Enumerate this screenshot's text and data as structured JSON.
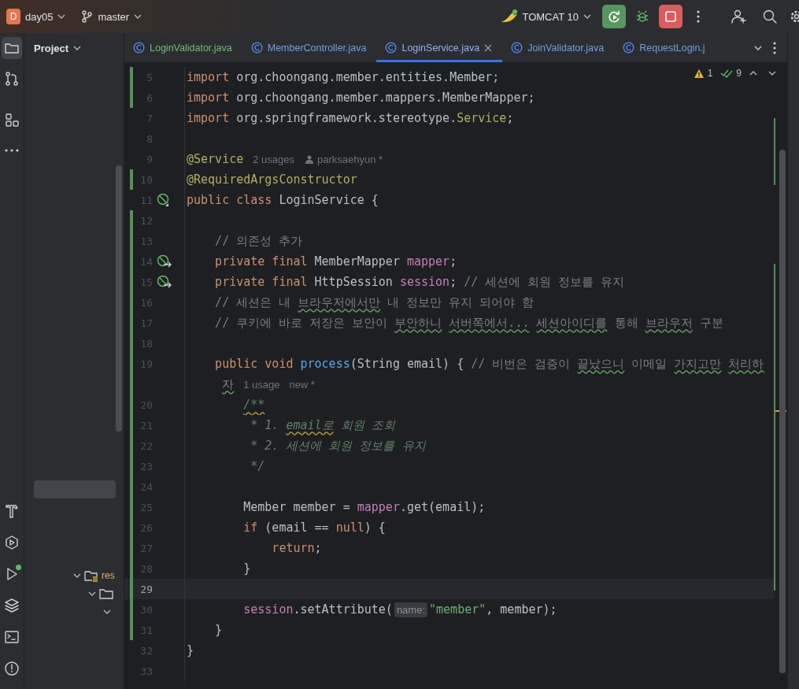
{
  "toolbar": {
    "project_badge": "D",
    "project": "day05",
    "branch": "master",
    "run_config": "TOMCAT 10"
  },
  "tool_strip": [
    {
      "kind": "project",
      "selected": true,
      "indicator": false
    },
    {
      "kind": "commit",
      "selected": false,
      "indicator": false
    },
    {
      "kind": "structure",
      "selected": false,
      "indicator": false
    },
    {
      "kind": "more",
      "selected": false,
      "indicator": false
    },
    {
      "kind": "build",
      "selected": false,
      "indicator": false
    },
    {
      "kind": "services",
      "selected": false,
      "indicator": false
    },
    {
      "kind": "run",
      "selected": false,
      "indicator": true
    },
    {
      "kind": "layers",
      "selected": false,
      "indicator": false
    },
    {
      "kind": "terminal",
      "selected": false,
      "indicator": false
    },
    {
      "kind": "problems",
      "selected": false,
      "indicator": false
    }
  ],
  "project_panel": {
    "title": "Project",
    "tree": [
      {
        "label": "res",
        "kind": "resources-folder",
        "expanded": true,
        "children": [
          {
            "kind": "folder",
            "expanded": true,
            "children": [
              {
                "expanded": true
              }
            ]
          }
        ]
      }
    ]
  },
  "tabs": [
    {
      "label": "LoginValidator.java",
      "color": "#73bd79",
      "selected": false
    },
    {
      "label": "MemberController.java",
      "color": "#6f9fe8",
      "selected": false
    },
    {
      "label": "LoginService.java",
      "color": "#8fb3f2",
      "selected": true
    },
    {
      "label": "JoinValidator.java",
      "color": "#6f9fe8",
      "selected": false
    },
    {
      "label": "RequestLogin.j",
      "color": "#6f9fe8",
      "selected": false
    }
  ],
  "inspections": {
    "warnings": "1",
    "weak_warnings": "9"
  },
  "editor": {
    "lines": [
      {
        "number": "5",
        "changed": true,
        "current": false,
        "tokens": [
          {
            "kind": "keyword",
            "text": "import"
          },
          {
            "kind": "plain",
            "text": " org.choongang.member.entities.Member;"
          }
        ]
      },
      {
        "number": "6",
        "changed": true,
        "current": false,
        "tokens": [
          {
            "kind": "keyword",
            "text": "import"
          },
          {
            "kind": "plain",
            "text": " org.choongang.member.mappers.MemberMapper;"
          }
        ]
      },
      {
        "number": "7",
        "changed": false,
        "current": false,
        "tokens": [
          {
            "kind": "keyword",
            "text": "import"
          },
          {
            "kind": "plain",
            "text": " org.springframework.stereotype."
          },
          {
            "kind": "annotation",
            "text": "Service"
          },
          {
            "kind": "plain",
            "text": ";"
          }
        ]
      },
      {
        "number": "8",
        "changed": false,
        "current": false
      },
      {
        "number": "9",
        "changed": false,
        "current": false,
        "tokens": [
          {
            "kind": "annotation",
            "text": "@Service"
          },
          {
            "kind": "hint",
            "text": "2 usages"
          },
          {
            "kind": "author",
            "text": "parksaehyun *"
          }
        ]
      },
      {
        "number": "10",
        "changed": true,
        "current": false,
        "tokens": [
          {
            "kind": "annotation",
            "text": "@RequiredArgsConstructor"
          }
        ]
      },
      {
        "number": "11",
        "changed": false,
        "current": false,
        "gutter": {
          "kind": "bean"
        },
        "tokens": [
          {
            "kind": "keyword",
            "text": "public class"
          },
          {
            "kind": "plain",
            "text": " LoginService {"
          }
        ]
      },
      {
        "number": "12",
        "changed": true,
        "current": false
      },
      {
        "number": "13",
        "changed": true,
        "current": false,
        "tokens": [
          {
            "kind": "comment",
            "text": "    // 의존성 추가"
          }
        ]
      },
      {
        "number": "14",
        "changed": true,
        "current": false,
        "gutter": {
          "kind": "injected-bean"
        },
        "tokens": [
          {
            "kind": "keyword",
            "text": "    private final"
          },
          {
            "kind": "plain",
            "text": " MemberMapper "
          },
          {
            "kind": "field",
            "text": "mapper"
          },
          {
            "kind": "plain",
            "text": ";"
          }
        ]
      },
      {
        "number": "15",
        "changed": true,
        "current": false,
        "gutter": {
          "kind": "injected-bean"
        },
        "tokens": [
          {
            "kind": "keyword",
            "text": "    private final"
          },
          {
            "kind": "plain",
            "text": " HttpSession "
          },
          {
            "kind": "field",
            "text": "session"
          },
          {
            "kind": "plain",
            "text": "; "
          },
          {
            "kind": "comment",
            "text": "// 세션에 회원 정보를 유지"
          }
        ]
      },
      {
        "number": "16",
        "changed": true,
        "current": false,
        "tokens": [
          {
            "kind": "comment",
            "text": "    // 세션은 내 "
          },
          {
            "kind": "comment-typo",
            "text": "브라우저에서만"
          },
          {
            "kind": "comment",
            "text": " 내 정보만 유지 되어야 함"
          }
        ]
      },
      {
        "number": "17",
        "changed": true,
        "current": false,
        "tokens": [
          {
            "kind": "comment",
            "text": "    // 쿠키에 바로 저장은 보안이 "
          },
          {
            "kind": "comment-typo",
            "text": "부안하니"
          },
          {
            "kind": "comment-typo",
            "text": " 서버쪽에서..."
          },
          {
            "kind": "comment-typo",
            "text": " 세션아이디를"
          },
          {
            "kind": "comment",
            "text": " 통해 "
          },
          {
            "kind": "comment-typo",
            "text": "브라우저"
          },
          {
            "kind": "comment",
            "text": " 구분"
          }
        ]
      },
      {
        "number": "18",
        "changed": true,
        "current": false
      },
      {
        "number": "19",
        "changed": true,
        "current": false,
        "tokens": [
          {
            "kind": "keyword",
            "text": "    public void "
          },
          {
            "kind": "method",
            "text": "process"
          },
          {
            "kind": "plain",
            "text": "(String email) { "
          },
          {
            "kind": "comment",
            "text": "// 비번은 검증이 "
          },
          {
            "kind": "comment-typo",
            "text": "끝났으니"
          },
          {
            "kind": "comment",
            "text": " 이메일 "
          },
          {
            "kind": "comment-typo",
            "text": "가지고만"
          },
          {
            "kind": "comment-typo",
            "text": " 처리하"
          }
        ],
        "continuation": [
          {
            "kind": "comment-typo",
            "text": "     자"
          },
          {
            "kind": "hint",
            "text": "1 usage"
          },
          {
            "kind": "hint",
            "text": "new *"
          }
        ]
      },
      {
        "number": "20",
        "changed": true,
        "current": false,
        "tokens": [
          {
            "kind": "doc-typo",
            "text": "        /**"
          }
        ]
      },
      {
        "number": "21",
        "changed": true,
        "current": false,
        "tokens": [
          {
            "kind": "doc",
            "text": "         * 1. "
          },
          {
            "kind": "doc-typo",
            "text": "email로"
          },
          {
            "kind": "doc",
            "text": " 회원 조회"
          }
        ]
      },
      {
        "number": "22",
        "changed": true,
        "current": false,
        "tokens": [
          {
            "kind": "doc",
            "text": "         * 2. 세션에 회원 정보를 유지"
          }
        ]
      },
      {
        "number": "23",
        "changed": true,
        "current": false,
        "tokens": [
          {
            "kind": "doc",
            "text": "         */"
          }
        ]
      },
      {
        "number": "24",
        "changed": true,
        "current": false
      },
      {
        "number": "25",
        "changed": true,
        "current": false,
        "tokens": [
          {
            "kind": "plain",
            "text": "        Member member = "
          },
          {
            "kind": "field",
            "text": "mapper"
          },
          {
            "kind": "plain",
            "text": ".get(email);"
          }
        ]
      },
      {
        "number": "26",
        "changed": true,
        "current": false,
        "tokens": [
          {
            "kind": "keyword",
            "text": "        if"
          },
          {
            "kind": "plain",
            "text": " (email == "
          },
          {
            "kind": "keyword",
            "text": "null"
          },
          {
            "kind": "plain",
            "text": ") {"
          }
        ]
      },
      {
        "number": "27",
        "changed": true,
        "current": false,
        "tokens": [
          {
            "kind": "keyword",
            "text": "            return"
          },
          {
            "kind": "plain",
            "text": ";"
          }
        ]
      },
      {
        "number": "28",
        "changed": true,
        "current": false,
        "tokens": [
          {
            "kind": "plain",
            "text": "        }"
          }
        ]
      },
      {
        "number": "29",
        "changed": true,
        "current": true
      },
      {
        "number": "30",
        "changed": true,
        "current": false,
        "tokens": [
          {
            "kind": "field",
            "text": "        session"
          },
          {
            "kind": "plain",
            "text": ".setAttribute("
          },
          {
            "kind": "param-hint",
            "text": "name:"
          },
          {
            "kind": "string",
            "text": "\"member\""
          },
          {
            "kind": "plain",
            "text": ", member);"
          }
        ]
      },
      {
        "number": "31",
        "changed": true,
        "current": false,
        "tokens": [
          {
            "kind": "plain",
            "text": "    }"
          }
        ]
      },
      {
        "number": "32",
        "changed": false,
        "current": false,
        "tokens": [
          {
            "kind": "plain",
            "text": "}"
          }
        ]
      },
      {
        "number": "33",
        "changed": false,
        "current": false
      }
    ]
  }
}
